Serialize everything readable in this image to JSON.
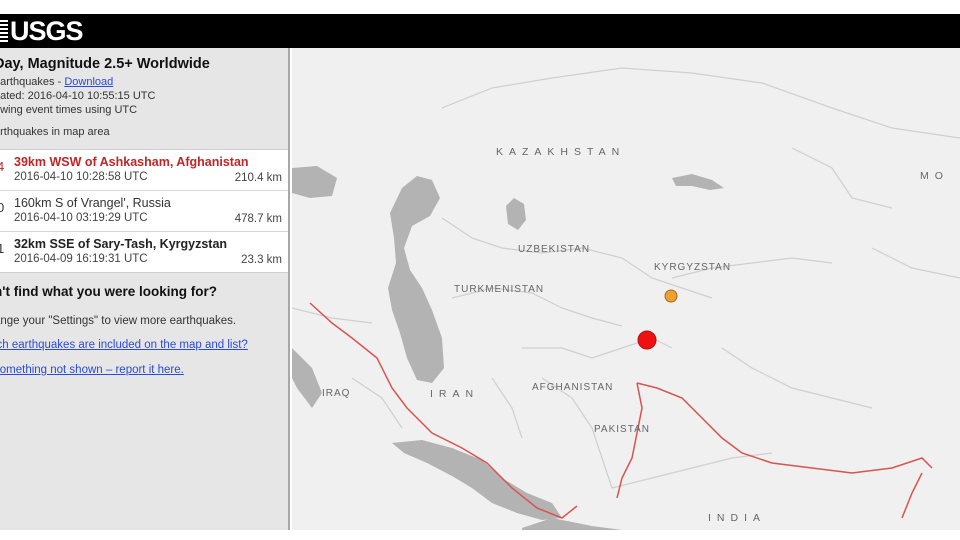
{
  "header": {
    "logo_text": "USGS"
  },
  "sidebar": {
    "feed_title": "Day, Magnitude 2.5+ Worldwide",
    "feed_prefix": "earthquakes - ",
    "feed_link": "Download",
    "updated": "dated: 2016-04-10 10:55:15 UTC",
    "times_note": "owing event times using UTC",
    "area_note": "arthquakes in map area",
    "earthquakes": [
      {
        "mag": "4",
        "place": "39km WSW of Ashkasham, Afghanistan",
        "time": "2016-04-10 10:28:58 UTC",
        "depth": "210.4 km"
      },
      {
        "mag": "0",
        "place": "160km S of Vrangel', Russia",
        "time": "2016-04-10 03:19:29 UTC",
        "depth": "478.7 km"
      },
      {
        "mag": "1",
        "place": "32km SSE of Sary-Tash, Kyrgyzstan",
        "time": "2016-04-09 16:19:31 UTC",
        "depth": "23.3 km"
      }
    ],
    "help_title": "n't find what you were looking for?",
    "help_text": "ange your \"Settings\" to view more earthquakes.",
    "help_link_1": "ich earthquakes are included on the map and list?",
    "help_link_2": "something not shown – report it here."
  },
  "map": {
    "labels": {
      "kazakhstan": "KAZAKHSTAN",
      "uzbekistan": "UZBEKISTAN",
      "kyrgyzstan": "KYRGYZSTAN",
      "turkmenistan": "TURKMENISTAN",
      "afghanistan": "AFGHANISTAN",
      "iraq": "IRAQ",
      "iran": "IRAN",
      "pakistan": "PAKISTAN",
      "india": "INDIA",
      "mongolia_partial": "MO"
    },
    "colors": {
      "land": "#f0f0f0",
      "water": "#b3b3b3",
      "border": "#cfcfcf",
      "plate_boundary": "#d9534f",
      "quake_large": "#ee1111",
      "quake_small": "#f0a030"
    }
  }
}
